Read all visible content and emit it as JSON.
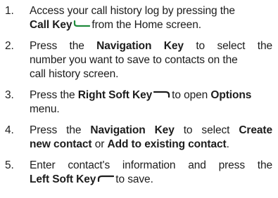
{
  "steps": [
    {
      "number": "1.",
      "line1": "Access your call history log by pressing the",
      "bold1": "Call Key",
      "after_icon": "from the Home screen.",
      "icon": "call-key-icon"
    },
    {
      "number": "2.",
      "line1_pre": "Press the",
      "bold1": "Navigation Key",
      "line1_post": "to select the",
      "line2": "number you want to save to contacts on the",
      "line3": "call history screen."
    },
    {
      "number": "3.",
      "line1_pre": "Press the",
      "bold1": "Right Soft Key",
      "line1_mid": "to open",
      "bold2": "Options",
      "line2": "menu.",
      "icon": "right-soft-key-icon"
    },
    {
      "number": "4.",
      "line1_pre": "Press the",
      "bold1": "Navigation Key",
      "line1_mid": "to select",
      "bold2": "Create",
      "bold3": "new contact",
      "line2_mid": "or",
      "bold4": "Add to existing contact",
      "line2_end": "."
    },
    {
      "number": "5.",
      "line1": "Enter contact's information and press the",
      "bold1": "Left Soft Key",
      "after_icon": "to save.",
      "icon": "left-soft-key-icon"
    }
  ],
  "colors": {
    "icon_green": "#1f8a3c",
    "text": "#1c1c1c"
  }
}
